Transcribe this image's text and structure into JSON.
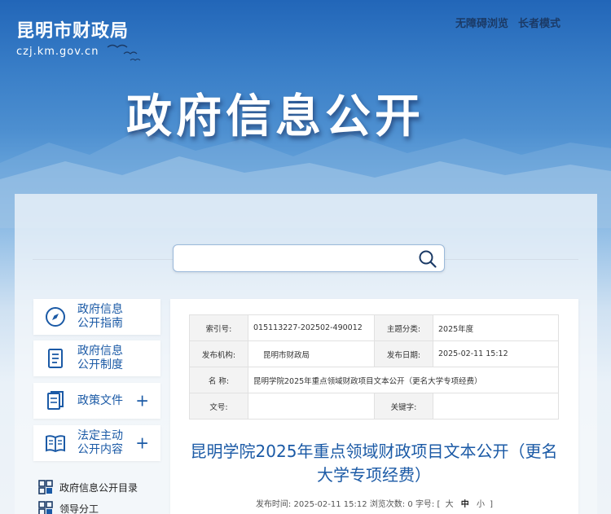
{
  "header": {
    "site_name": "昆明市财政局",
    "domain": "czj.km.gov.cn",
    "nav": [
      "无障碍浏览",
      "长者模式"
    ]
  },
  "banner": {
    "title": "政府信息公开"
  },
  "search": {
    "placeholder": "",
    "value": ""
  },
  "sidebar": {
    "items": [
      {
        "line1": "政府信息",
        "line2": "公开指南",
        "icon": "compass-icon",
        "expandable": false
      },
      {
        "line1": "政府信息",
        "line2": "公开制度",
        "icon": "document-icon",
        "expandable": false
      },
      {
        "line1": "政策文件",
        "line2": "",
        "icon": "files-icon",
        "expandable": true
      },
      {
        "line1": "法定主动",
        "line2": "公开内容",
        "icon": "book-icon",
        "expandable": true
      }
    ],
    "plus_symbol": "+",
    "subitems": [
      {
        "label": "政府信息公开目录",
        "icon": "catalog-grid-icon"
      },
      {
        "label": "领导分工",
        "icon": "catalog-grid-icon"
      }
    ]
  },
  "meta": {
    "index_label": "索引号:",
    "index_value": "015113227-202502-490012",
    "category_label": "主题分类:",
    "category_value": "2025年度",
    "org_label": "发布机构:",
    "org_value": "昆明市财政局",
    "date_label": "发布日期:",
    "date_value": "2025-02-11 15:12",
    "name_label": "名 称:",
    "name_value": "昆明学院2025年重点领域财政项目文本公开（更名大学专项经费）",
    "docno_label": "文号:",
    "docno_value": "",
    "keyword_label": "关键字:",
    "keyword_value": ""
  },
  "article": {
    "title": "昆明学院2025年重点领域财政项目文本公开（更名大学专项经费）",
    "pub_time_label": "发布时间:",
    "pub_time": "2025-02-11 15:12",
    "views_label": "浏览次数:",
    "views": "0",
    "font_label": "字号:",
    "bracket_open": "[",
    "bracket_close": "]",
    "font_sizes": [
      "大",
      "中",
      "小"
    ]
  }
}
